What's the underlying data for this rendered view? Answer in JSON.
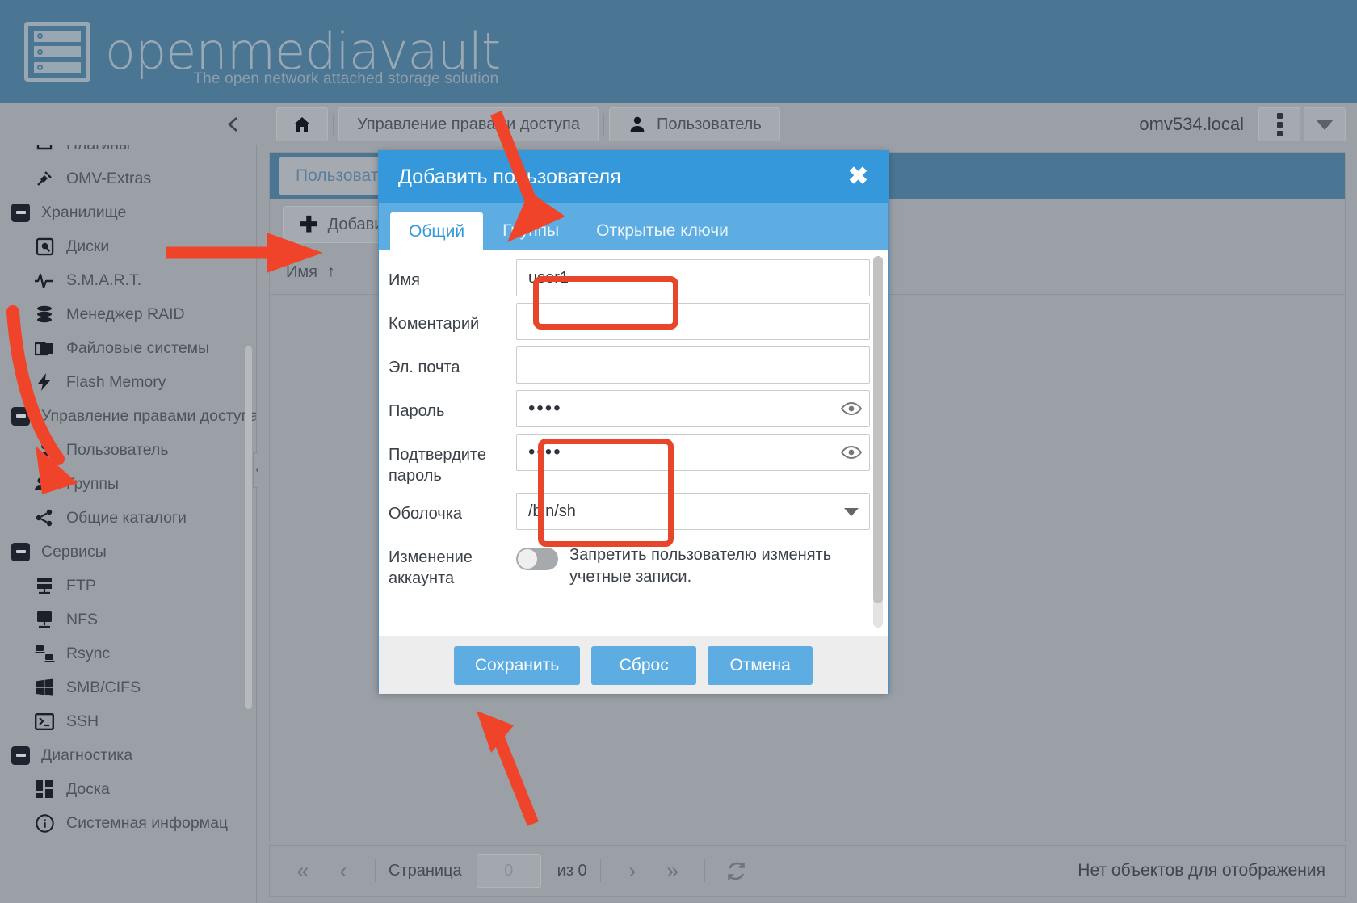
{
  "brand": {
    "name": "openmediavault",
    "tagline": "The open network attached storage solution",
    "logo_icon": "server-rack-icon"
  },
  "topbar": {
    "collapse_icon": "chevron-left-icon",
    "home_icon": "home-icon",
    "breadcrumbs": [
      {
        "label": "Управление правами доступа",
        "icon": ""
      },
      {
        "label": "Пользователь",
        "icon": "user-icon"
      }
    ],
    "hostname": "omv534.local",
    "menu_icon": "kebab-menu-icon",
    "dropdown_icon": "caret-down-icon"
  },
  "sidebar": {
    "items": [
      {
        "label": "Плагины",
        "icon": "puzzle-icon",
        "level": "child"
      },
      {
        "label": "OMV-Extras",
        "icon": "plug-icon",
        "level": "child"
      },
      {
        "label": "Хранилище",
        "icon": "box-minus-icon",
        "level": "group"
      },
      {
        "label": "Диски",
        "icon": "hard-disk-icon",
        "level": "child"
      },
      {
        "label": "S.M.A.R.T.",
        "icon": "pulse-icon",
        "level": "child"
      },
      {
        "label": "Менеджер RAID",
        "icon": "database-icon",
        "level": "child"
      },
      {
        "label": "Файловые системы",
        "icon": "folders-icon",
        "level": "child"
      },
      {
        "label": "Flash Memory",
        "icon": "bolt-icon",
        "level": "child"
      },
      {
        "label": "Управление правами доступа",
        "icon": "box-minus-icon",
        "level": "group"
      },
      {
        "label": "Пользователь",
        "icon": "user-icon",
        "level": "child"
      },
      {
        "label": "Группы",
        "icon": "users-icon",
        "level": "child"
      },
      {
        "label": "Общие каталоги",
        "icon": "share-icon",
        "level": "child"
      },
      {
        "label": "Сервисы",
        "icon": "box-minus-icon",
        "level": "group"
      },
      {
        "label": "FTP",
        "icon": "server-icon",
        "level": "child"
      },
      {
        "label": "NFS",
        "icon": "monitor-icon",
        "level": "child"
      },
      {
        "label": "Rsync",
        "icon": "sync-computers-icon",
        "level": "child"
      },
      {
        "label": "SMB/CIFS",
        "icon": "windows-icon",
        "level": "child"
      },
      {
        "label": "SSH",
        "icon": "terminal-icon",
        "level": "child"
      },
      {
        "label": "Диагностика",
        "icon": "box-minus-icon",
        "level": "group"
      },
      {
        "label": "Доска",
        "icon": "dashboard-icon",
        "level": "child"
      },
      {
        "label": "Системная информац",
        "icon": "info-icon",
        "level": "child"
      }
    ]
  },
  "panel": {
    "title": "Пользователь",
    "add_button": "Добавить",
    "add_icon": "plus-icon",
    "column_header": "Имя",
    "sort_icon": "sort-ascending-icon"
  },
  "pager": {
    "first_icon": "double-chevron-left-icon",
    "prev_icon": "chevron-left-icon",
    "page_label": "Страница",
    "page_value": "0",
    "of_label": "из 0",
    "next_icon": "chevron-right-icon",
    "last_icon": "double-chevron-right-icon",
    "refresh_icon": "refresh-icon",
    "empty_text": "Нет объектов для отображения"
  },
  "dialog": {
    "title": "Добавить пользователя",
    "close_icon": "close-icon",
    "tabs": [
      {
        "label": "Общий",
        "active": true
      },
      {
        "label": "Группы",
        "active": false
      },
      {
        "label": "Открытые ключи",
        "active": false
      }
    ],
    "fields": {
      "name": {
        "label": "Имя",
        "value": "user1",
        "placeholder": ""
      },
      "comment": {
        "label": "Коментарий",
        "value": "",
        "placeholder": ""
      },
      "email": {
        "label": "Эл. почта",
        "value": "",
        "placeholder": ""
      },
      "password": {
        "label": "Пароль",
        "value": "••••",
        "reveal_icon": "eye-icon"
      },
      "password_confirm": {
        "label": "Подтвердите пароль",
        "value": "••••",
        "reveal_icon": "eye-icon"
      },
      "shell": {
        "label": "Оболочка",
        "value": "/bin/sh",
        "caret_icon": "caret-down-icon"
      },
      "account_modify": {
        "label": "Изменение аккаунта",
        "toggle_state": "off",
        "text": "Запретить пользователю изменять учетные записи."
      }
    },
    "buttons": {
      "save": "Сохранить",
      "reset": "Сброс",
      "cancel": "Отмена"
    }
  },
  "colors": {
    "brand_header": "#4a7694",
    "dialog_header": "#3498db",
    "dialog_tabs": "#5dade2",
    "button_blue": "#5dade2",
    "annotation_red": "#e8462a",
    "chrome_gray": "#9ba0a6"
  }
}
